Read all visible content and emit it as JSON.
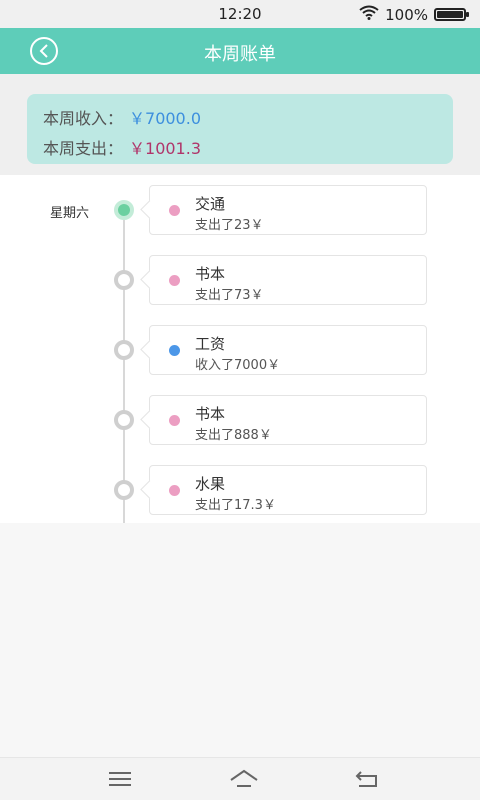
{
  "status_bar": {
    "time": "12:20",
    "battery_text": "100%",
    "battery_level": 1.0,
    "icons": [
      "wifi-icon",
      "battery-icon"
    ]
  },
  "header": {
    "title": "本周账单",
    "back_icon": "back-circle-icon"
  },
  "summary": {
    "income_label": "本周收入：",
    "income_value": "￥7000.0",
    "expense_label": "本周支出：",
    "expense_value": "￥1001.3"
  },
  "timeline": {
    "day_label": "星期六",
    "entries": [
      {
        "category": "交通",
        "detail": "支出了23￥",
        "type": "expense",
        "dot_color": "#ec9ec2",
        "active": true
      },
      {
        "category": "书本",
        "detail": "支出了73￥",
        "type": "expense",
        "dot_color": "#ec9ec2",
        "active": false
      },
      {
        "category": "工资",
        "detail": "收入了7000￥",
        "type": "income",
        "dot_color": "#4c97e8",
        "active": false
      },
      {
        "category": "书本",
        "detail": "支出了888￥",
        "type": "expense",
        "dot_color": "#ec9ec2",
        "active": false
      },
      {
        "category": "水果",
        "detail": "支出了17.3￥",
        "type": "expense",
        "dot_color": "#ec9ec2",
        "active": false
      }
    ]
  },
  "colors": {
    "accent": "#5ecdb9",
    "summary_bg": "#bde8e3",
    "income": "#3d8fde",
    "expense": "#b0356a"
  },
  "nav": {
    "icons": [
      "menu-icon",
      "home-icon",
      "back-icon"
    ]
  }
}
